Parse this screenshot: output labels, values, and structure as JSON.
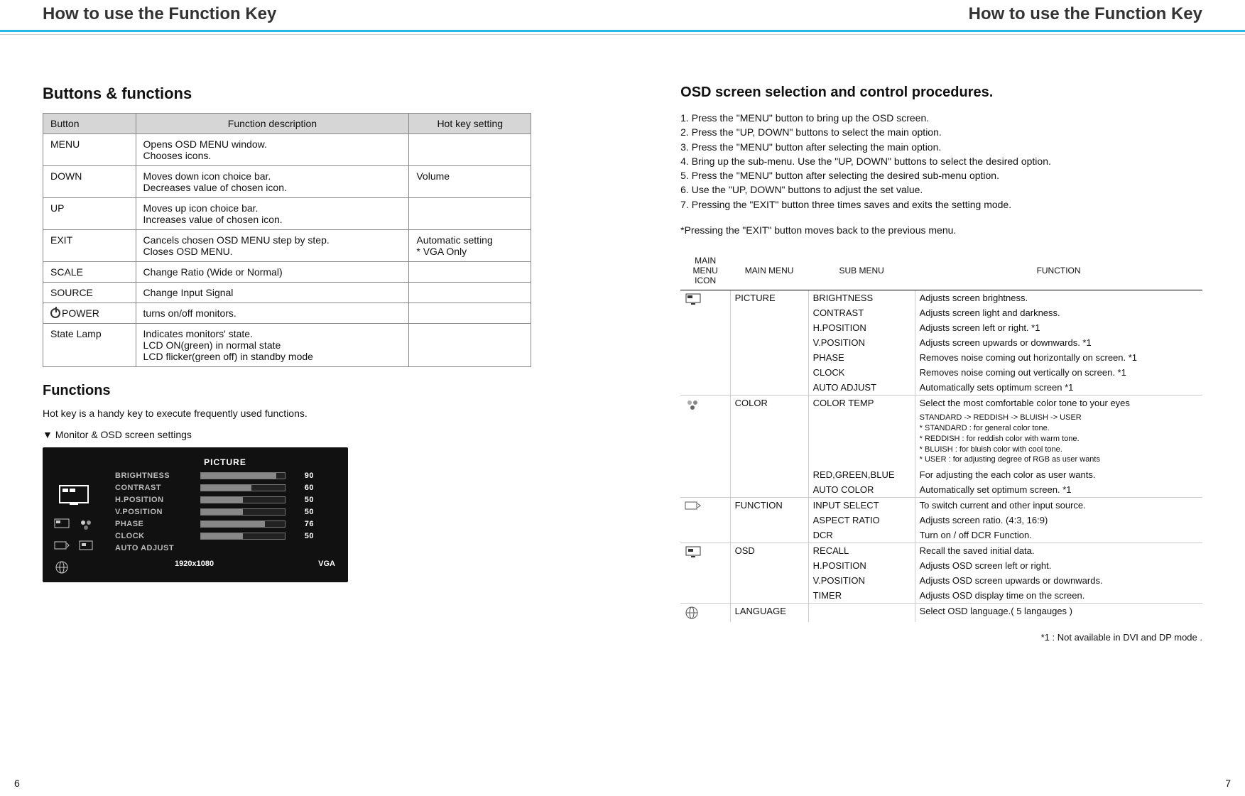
{
  "header": {
    "left": "How to use the Function Key",
    "right": "How to use the Function Key"
  },
  "left_page": {
    "section_title": "Buttons & functions",
    "table": {
      "headers": [
        "Button",
        "Function description",
        "Hot key setting"
      ],
      "rows": [
        {
          "button": "MENU",
          "desc": "Opens OSD MENU window.\nChooses icons.",
          "hot": ""
        },
        {
          "button": "DOWN",
          "desc": "Moves down icon choice bar.\nDecreases value of chosen icon.",
          "hot": "Volume"
        },
        {
          "button": "UP",
          "desc": "Moves up icon choice bar.\nIncreases value of chosen icon.",
          "hot": ""
        },
        {
          "button": "EXIT",
          "desc": "Cancels chosen OSD MENU step by step.\nCloses OSD MENU.",
          "hot": "Automatic setting\n* VGA Only"
        },
        {
          "button": "SCALE",
          "desc": "Change Ratio (Wide or Normal)",
          "hot": ""
        },
        {
          "button": "SOURCE",
          "desc": "Change Input Signal",
          "hot": ""
        },
        {
          "button": "POWER",
          "desc": "turns on/off monitors.",
          "hot": "",
          "power_icon": true
        },
        {
          "button": "State Lamp",
          "desc": "Indicates monitors' state.\nLCD ON(green) in normal state\nLCD flicker(green off) in standby mode",
          "hot": ""
        }
      ]
    },
    "functions_h": "Functions",
    "functions_note": "Hot key is a handy key to execute frequently used functions.",
    "functions_sub": "▼ Monitor & OSD screen settings",
    "osd": {
      "title": "PICTURE",
      "rows": [
        {
          "label": "BRIGHTNESS",
          "value": 90
        },
        {
          "label": "CONTRAST",
          "value": 60
        },
        {
          "label": "H.POSITION",
          "value": 50
        },
        {
          "label": "V.POSITION",
          "value": 50
        },
        {
          "label": "PHASE",
          "value": 76
        },
        {
          "label": "CLOCK",
          "value": 50
        }
      ],
      "auto_label": "AUTO ADJUST",
      "resolution": "1920x1080",
      "source": "VGA"
    }
  },
  "right_page": {
    "section_title": "OSD screen selection and control procedures.",
    "steps": [
      "1. Press the \"MENU\" button to bring up the OSD screen.",
      "2. Press the \"UP, DOWN\" buttons to select the main option.",
      "3. Press the \"MENU\" button after selecting the main option.",
      "4. Bring up the sub-menu. Use the \"UP, DOWN\" buttons to select the desired option.",
      "5. Press the \"MENU\" button after selecting the desired sub-menu option.",
      "6. Use the \"UP, DOWN\" buttons to adjust the set value.",
      "7. Pressing the \"EXIT\" button three times saves and exits the setting mode."
    ],
    "exit_note": "*Pressing the \"EXIT\" button moves back to the previous menu.",
    "menu_headers": [
      "MAIN MENU ICON",
      "MAIN MENU",
      "SUB MENU",
      "FUNCTION"
    ],
    "groups": [
      {
        "icon": "monitor-icon",
        "main": "PICTURE",
        "subs": [
          {
            "sub": "BRIGHTNESS",
            "func": "Adjusts screen brightness."
          },
          {
            "sub": "CONTRAST",
            "func": "Adjusts screen light and darkness."
          },
          {
            "sub": "H.POSITION",
            "func": "Adjusts screen left or right. *1"
          },
          {
            "sub": "V.POSITION",
            "func": "Adjusts screen upwards or downwards. *1"
          },
          {
            "sub": "PHASE",
            "func": "Removes noise coming out horizontally on screen. *1"
          },
          {
            "sub": "CLOCK",
            "func": "Removes noise coming out vertically on screen. *1"
          },
          {
            "sub": "AUTO ADJUST",
            "func": "Automatically sets optimum screen *1"
          }
        ]
      },
      {
        "icon": "color-dots-icon",
        "main": "COLOR",
        "subs": [
          {
            "sub": "COLOR TEMP",
            "func": "Select the most comfortable color tone to your eyes",
            "detail": "STANDARD -> REDDISH -> BLUISH -> USER\n* STANDARD : for general color tone.\n* REDDISH : for reddish color with warm tone.\n* BLUISH : for bluish color with cool tone.\n* USER : for adjusting degree of RGB as user wants"
          },
          {
            "sub": "RED,GREEN,BLUE",
            "func": "For adjusting the each color as user wants."
          },
          {
            "sub": "AUTO COLOR",
            "func": "Automatically set optimum screen. *1"
          }
        ]
      },
      {
        "icon": "function-icon",
        "main": "FUNCTION",
        "subs": [
          {
            "sub": "INPUT SELECT",
            "func": "To switch current and other input source."
          },
          {
            "sub": "ASPECT RATIO",
            "func": "Adjusts screen ratio. (4:3, 16:9)"
          },
          {
            "sub": "DCR",
            "func": "Turn on / off DCR Function."
          }
        ]
      },
      {
        "icon": "osd-icon",
        "main": "OSD",
        "subs": [
          {
            "sub": "RECALL",
            "func": "Recall the saved initial data."
          },
          {
            "sub": "H.POSITION",
            "func": "Adjusts OSD screen left or right."
          },
          {
            "sub": "V.POSITION",
            "func": "Adjusts OSD screen upwards or downwards."
          },
          {
            "sub": "TIMER",
            "func": "Adjusts OSD display time on the screen."
          }
        ]
      },
      {
        "icon": "globe-icon",
        "main": "LANGUAGE",
        "subs": [
          {
            "sub": "",
            "func": "Select OSD language.( 5 langauges )"
          }
        ]
      }
    ],
    "footnote": "*1 : Not available in DVI and DP mode ."
  },
  "page_numbers": {
    "left": "6",
    "right": "7"
  }
}
